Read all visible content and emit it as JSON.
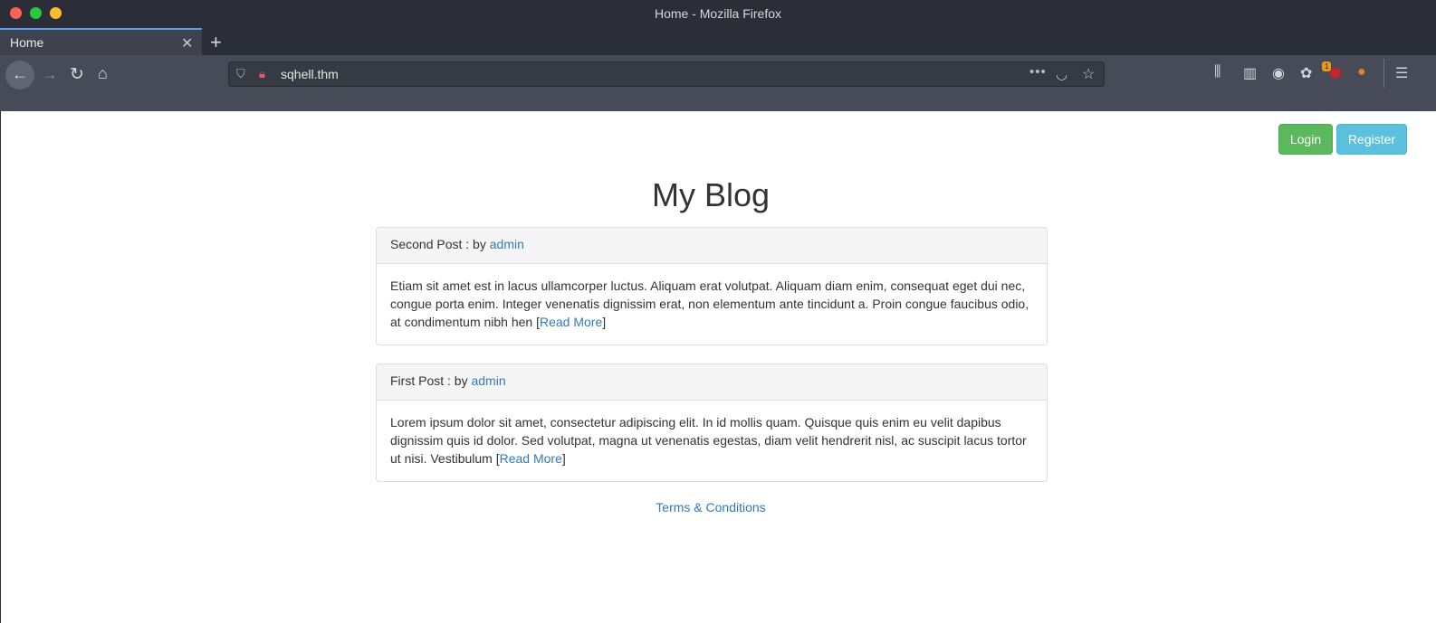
{
  "browser": {
    "window_title": "Home - Mozilla Firefox",
    "tab_label": "Home",
    "url": "sqhell.thm",
    "extension_badge": "1"
  },
  "header": {
    "login_label": "Login",
    "register_label": "Register"
  },
  "main": {
    "title": "My Blog",
    "posts": [
      {
        "title": "Second Post",
        "by_text": " : by ",
        "author": "admin",
        "excerpt": "Etiam sit amet est in lacus ullamcorper luctus. Aliquam erat volutpat. Aliquam diam enim, consequat eget dui nec, congue porta enim. Integer venenatis dignissim erat, non elementum ante tincidunt a. Proin congue faucibus odio, at condimentum nibh hen",
        "read_more": "Read More"
      },
      {
        "title": "First Post",
        "by_text": " : by ",
        "author": "admin",
        "excerpt": "Lorem ipsum dolor sit amet, consectetur adipiscing elit. In id mollis quam. Quisque quis enim eu velit dapibus dignissim quis id dolor. Sed volutpat, magna ut venenatis egestas, diam velit hendrerit nisl, ac suscipit lacus tortor ut nisi. Vestibulum",
        "read_more": "Read More"
      }
    ],
    "footer_link": "Terms & Conditions"
  }
}
